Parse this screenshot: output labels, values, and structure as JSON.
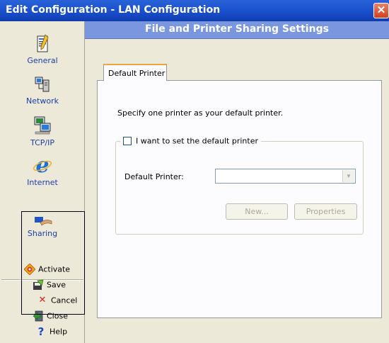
{
  "window": {
    "title": "Edit Configuration - LAN Configuration",
    "close_icon": "close-icon"
  },
  "header": {
    "title": "File and Printer Sharing Settings"
  },
  "sidebar": {
    "items": [
      {
        "label": "General",
        "icon": "general-icon"
      },
      {
        "label": "Network",
        "icon": "network-icon"
      },
      {
        "label": "TCP/IP",
        "icon": "tcpip-icon"
      },
      {
        "label": "Internet",
        "icon": "internet-explorer-icon"
      },
      {
        "label": "Sharing",
        "icon": "sharing-icon",
        "selected": true
      }
    ],
    "actions": [
      {
        "label": "Activate",
        "icon": "activate-icon"
      },
      {
        "label": "Save",
        "icon": "save-icon"
      },
      {
        "label": "Cancel",
        "icon": "cancel-icon"
      },
      {
        "label": "Close",
        "icon": "close-action-icon"
      },
      {
        "label": "Help",
        "icon": "help-icon"
      }
    ]
  },
  "tabs": [
    {
      "label": "Default Printer",
      "active": true
    }
  ],
  "default_printer": {
    "prompt": "Specify one printer as your default printer.",
    "checkbox_label": "I want to set the default printer",
    "checkbox_checked": false,
    "field_label": "Default Printer:",
    "field_value": "",
    "new_button": "New...",
    "properties_button": "Properties"
  },
  "colors": {
    "title_bar": "#1d54d0",
    "header_bar": "#7a96df",
    "sidebar_link": "#1a3ea8",
    "panel_bg": "#ece9d8"
  }
}
